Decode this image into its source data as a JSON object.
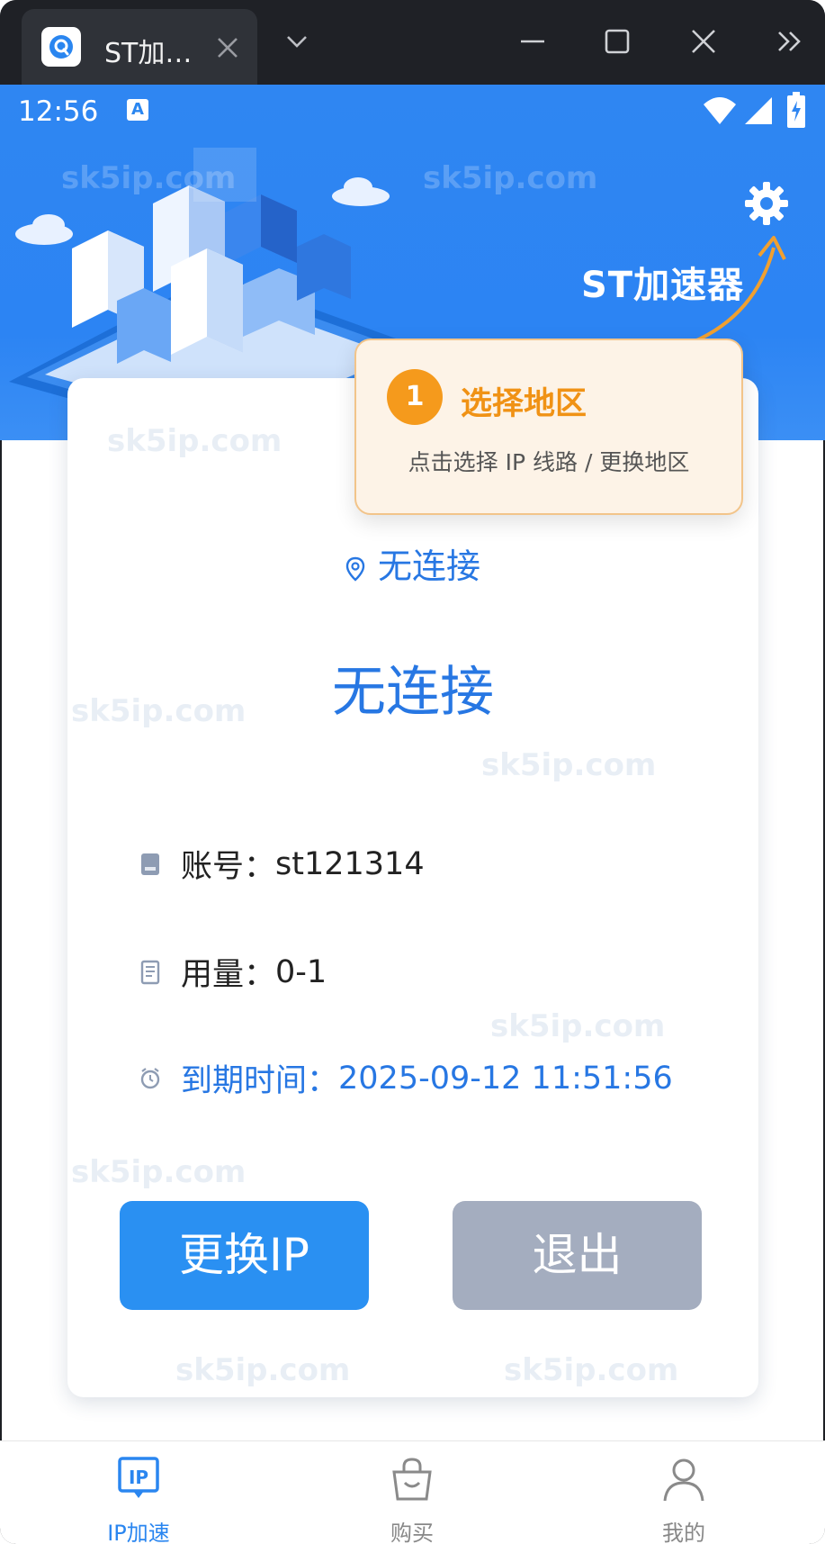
{
  "window": {
    "tab_title": "ST加…",
    "icons": [
      "app-icon",
      "close-icon",
      "chevron-down-icon",
      "minimize-icon",
      "maximize-icon",
      "close-icon",
      "double-chevron-right-icon"
    ]
  },
  "statusbar": {
    "time": "12:56",
    "badge": "A",
    "icons": [
      "wifi-icon",
      "signal-icon",
      "battery-icon"
    ]
  },
  "hero": {
    "brand": "ST加速器",
    "watermark": "sk5ip.com"
  },
  "tooltip": {
    "step": "1",
    "title": "选择地区",
    "desc": "点击选择 IP 线路 / 更换地区"
  },
  "connection": {
    "location": "无连接",
    "status": "无连接"
  },
  "info": {
    "account_label": "账号：",
    "account_value": "st121314",
    "usage_label": "用量：",
    "usage_value": "0-1",
    "expiry_label": "到期时间：",
    "expiry_value": "2025-09-12 11:51:56"
  },
  "buttons": {
    "change_ip": "更换IP",
    "exit": "退出"
  },
  "nav": [
    {
      "label": "IP加速",
      "icon": "ip-icon",
      "active": true
    },
    {
      "label": "购买",
      "icon": "shopping-bag-icon",
      "active": false
    },
    {
      "label": "我的",
      "icon": "user-icon",
      "active": false
    }
  ],
  "colors": {
    "primary": "#2a86f0",
    "accent_orange": "#f59a1c",
    "exit_button": "#a4adbf"
  }
}
